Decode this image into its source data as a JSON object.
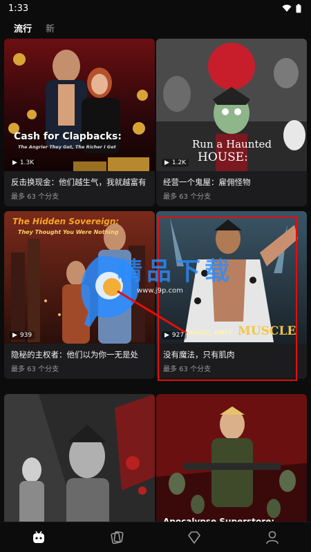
{
  "status": {
    "time": "1:33"
  },
  "tabs": [
    {
      "label": "流行",
      "active": true
    },
    {
      "label": "新",
      "active": false
    }
  ],
  "cards": [
    {
      "cover_text": "Cash for Clapbacks:",
      "cover_subtext": "The Angrier They Get, The Richer I Get",
      "plays": "1.3K",
      "title": "反击换现金：他们越生气，我就越富有",
      "sub": "最多 63 个分支"
    },
    {
      "cover_text": "Run a Haunted",
      "cover_subtext": "HOUSE:",
      "plays": "1.2K",
      "title": "经营一个鬼屋：雇佣怪物",
      "sub": "最多 63 个分支"
    },
    {
      "cover_text": "The Hidden Sovereign:",
      "cover_subtext": "They Thought You Were Nothing",
      "plays": "939",
      "title": "隐秘的主权者：他们以为你一无是处",
      "sub": "最多 63 个分支"
    },
    {
      "cover_text": "MAGIC, ONLY",
      "cover_subtext": "MUSCLE",
      "plays": "927",
      "title": "没有魔法，只有肌肉",
      "sub": "最多 63 个分支"
    },
    {
      "cover_text": "",
      "cover_subtext": "",
      "plays": "",
      "title": "",
      "sub": ""
    },
    {
      "cover_text": "Apocalypse Superstore:",
      "cover_subtext": "",
      "plays": "",
      "title": "",
      "sub": ""
    }
  ],
  "watermark": {
    "text": "精品下载",
    "url": "www.j9p.com"
  },
  "colors": {
    "background": "#0c0c0c",
    "card": "#1c1c1e",
    "highlight": "#e60d0d",
    "watermark": "#2a8cff"
  },
  "nav": [
    "home-icon",
    "cards-icon",
    "diamond-icon",
    "profile-icon"
  ]
}
